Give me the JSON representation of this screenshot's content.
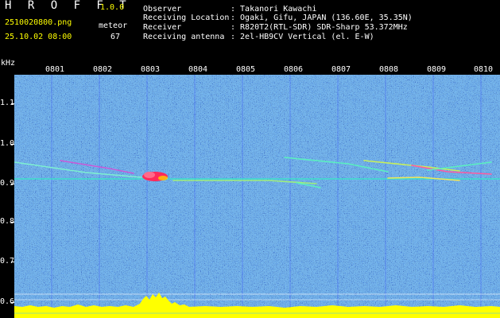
{
  "app": {
    "name": "H R O F F T",
    "version": "1.0.0"
  },
  "file": {
    "name": "2510020800.png",
    "datetime": "25.10.02 08:00"
  },
  "counter": {
    "label": "meteor",
    "value": "67"
  },
  "info": {
    "labels": [
      "Observer",
      "Receiving Location",
      "Receiver",
      "Receiving antenna"
    ],
    "values": [
      ": Takanori Kawachi",
      ": Ogaki, Gifu, JAPAN (136.60E, 35.35N)",
      ": R820T2(RTL-SDR) SDR-Sharp 53.372MHz",
      ": 2el-HB9CV Vertical (el. E-W)"
    ]
  },
  "axis": {
    "unit": "kHz",
    "y_ticks": [
      "1.1",
      "1.0",
      "0.9",
      "0.8",
      "0.7",
      "0.6"
    ],
    "x_ticks": [
      "0801",
      "0802",
      "0803",
      "0804",
      "0805",
      "0806",
      "0807",
      "0808",
      "0809",
      "0810"
    ]
  },
  "colors": {
    "background": "#000000",
    "spectrogram_base": "#0a1f8c",
    "noise_hi": "#1e6bff",
    "carrier": "#38e6c8",
    "meteor_echo": "#ff3a6a",
    "level_bar": "#ffff00"
  }
}
